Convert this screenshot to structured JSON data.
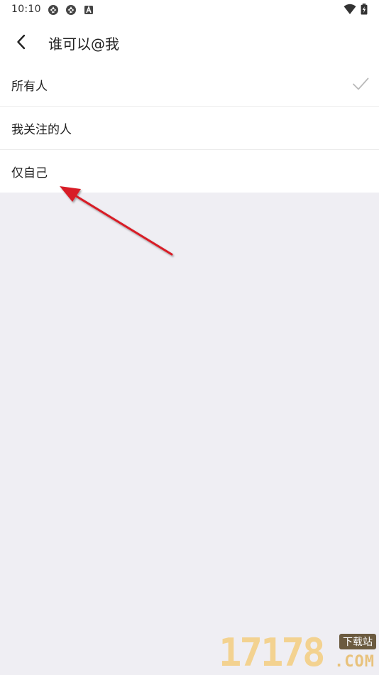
{
  "status_bar": {
    "time": "10:10",
    "icons": [
      "aperture-icon",
      "aperture-icon",
      "font-a-icon",
      "wifi-icon",
      "battery-charging-icon"
    ]
  },
  "header": {
    "title": "谁可以@我",
    "back_icon": "chevron-left-icon"
  },
  "options": [
    {
      "label": "所有人",
      "selected": true
    },
    {
      "label": "我关注的人",
      "selected": false
    },
    {
      "label": "仅自己",
      "selected": false
    }
  ],
  "annotation": {
    "arrow_color": "#d81f26"
  },
  "watermark": {
    "number": "17178",
    "badge": "下载站",
    "suffix": ".COM"
  },
  "colors": {
    "page_background": "#efeef3",
    "list_background": "#ffffff",
    "check": "#b9b9b9"
  }
}
